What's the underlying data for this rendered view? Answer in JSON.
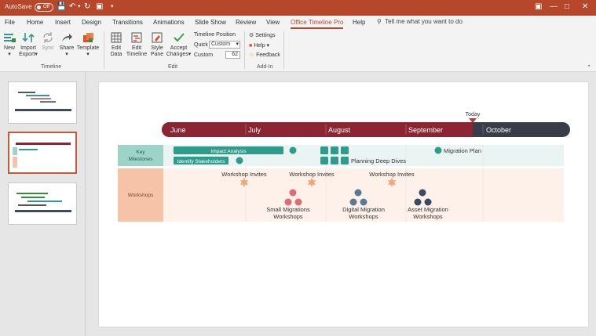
{
  "titlebar": {
    "autosave_label": "AutoSave",
    "autosave_state": "Off"
  },
  "tabs": [
    {
      "label": "File"
    },
    {
      "label": "Home"
    },
    {
      "label": "Insert"
    },
    {
      "label": "Design"
    },
    {
      "label": "Transitions"
    },
    {
      "label": "Animations"
    },
    {
      "label": "Slide Show"
    },
    {
      "label": "Review"
    },
    {
      "label": "View"
    },
    {
      "label": "Office Timeline Pro"
    },
    {
      "label": "Help"
    }
  ],
  "tellme": "Tell me what you want to do",
  "ribbon": {
    "new": "New",
    "import": "Import",
    "export": "Export",
    "sync": "Sync",
    "share": "Share",
    "template": "Template",
    "group_timeline": "Timeline",
    "edit_data_1": "Edit",
    "edit_data_2": "Data",
    "edit_timeline_1": "Edit",
    "edit_timeline_2": "Timeline",
    "style_pane_1": "Style",
    "style_pane_2": "Pane",
    "accept_1": "Accept",
    "accept_2": "Changes",
    "timeline_position": "Timeline Position",
    "quick_label": "Quick",
    "quick_value": "Custom",
    "custom_label": "Custom",
    "custom_value": "62",
    "group_edit": "Edit",
    "settings": "Settings",
    "help": "Help",
    "feedback": "Feedback",
    "group_addin": "Add-In"
  },
  "timeline": {
    "today_label": "Today",
    "months": [
      "June",
      "July",
      "August",
      "September",
      "October"
    ],
    "swimlanes": [
      {
        "label_1": "Key",
        "label_2": "Milestones"
      },
      {
        "label_1": "Workshops",
        "label_2": ""
      }
    ],
    "tasks": {
      "impact_analysis": "Impact Analysis",
      "identify_stakeholders": "Identify Stakeholders",
      "planning_deep_dives": "Planning Deep Dives",
      "migration_plan": "Migration Plan"
    },
    "workshops": {
      "invites": "Workshop Invites",
      "small_1": "Small Migrations",
      "small_2": "Workshops",
      "digital_1": "Digital Migration",
      "digital_2": "Workshops",
      "asset_1": "Asset Migration",
      "asset_2": "Workshops"
    }
  },
  "colors": {
    "brand": "#b7472a",
    "band_maroon": "#8b2433",
    "band_dark": "#3a3c4a",
    "teal": "#2f9b8a",
    "salmon": "#f0a679",
    "pink": "#e06a75",
    "slate": "#5a7a92",
    "navy": "#3c4a63"
  }
}
